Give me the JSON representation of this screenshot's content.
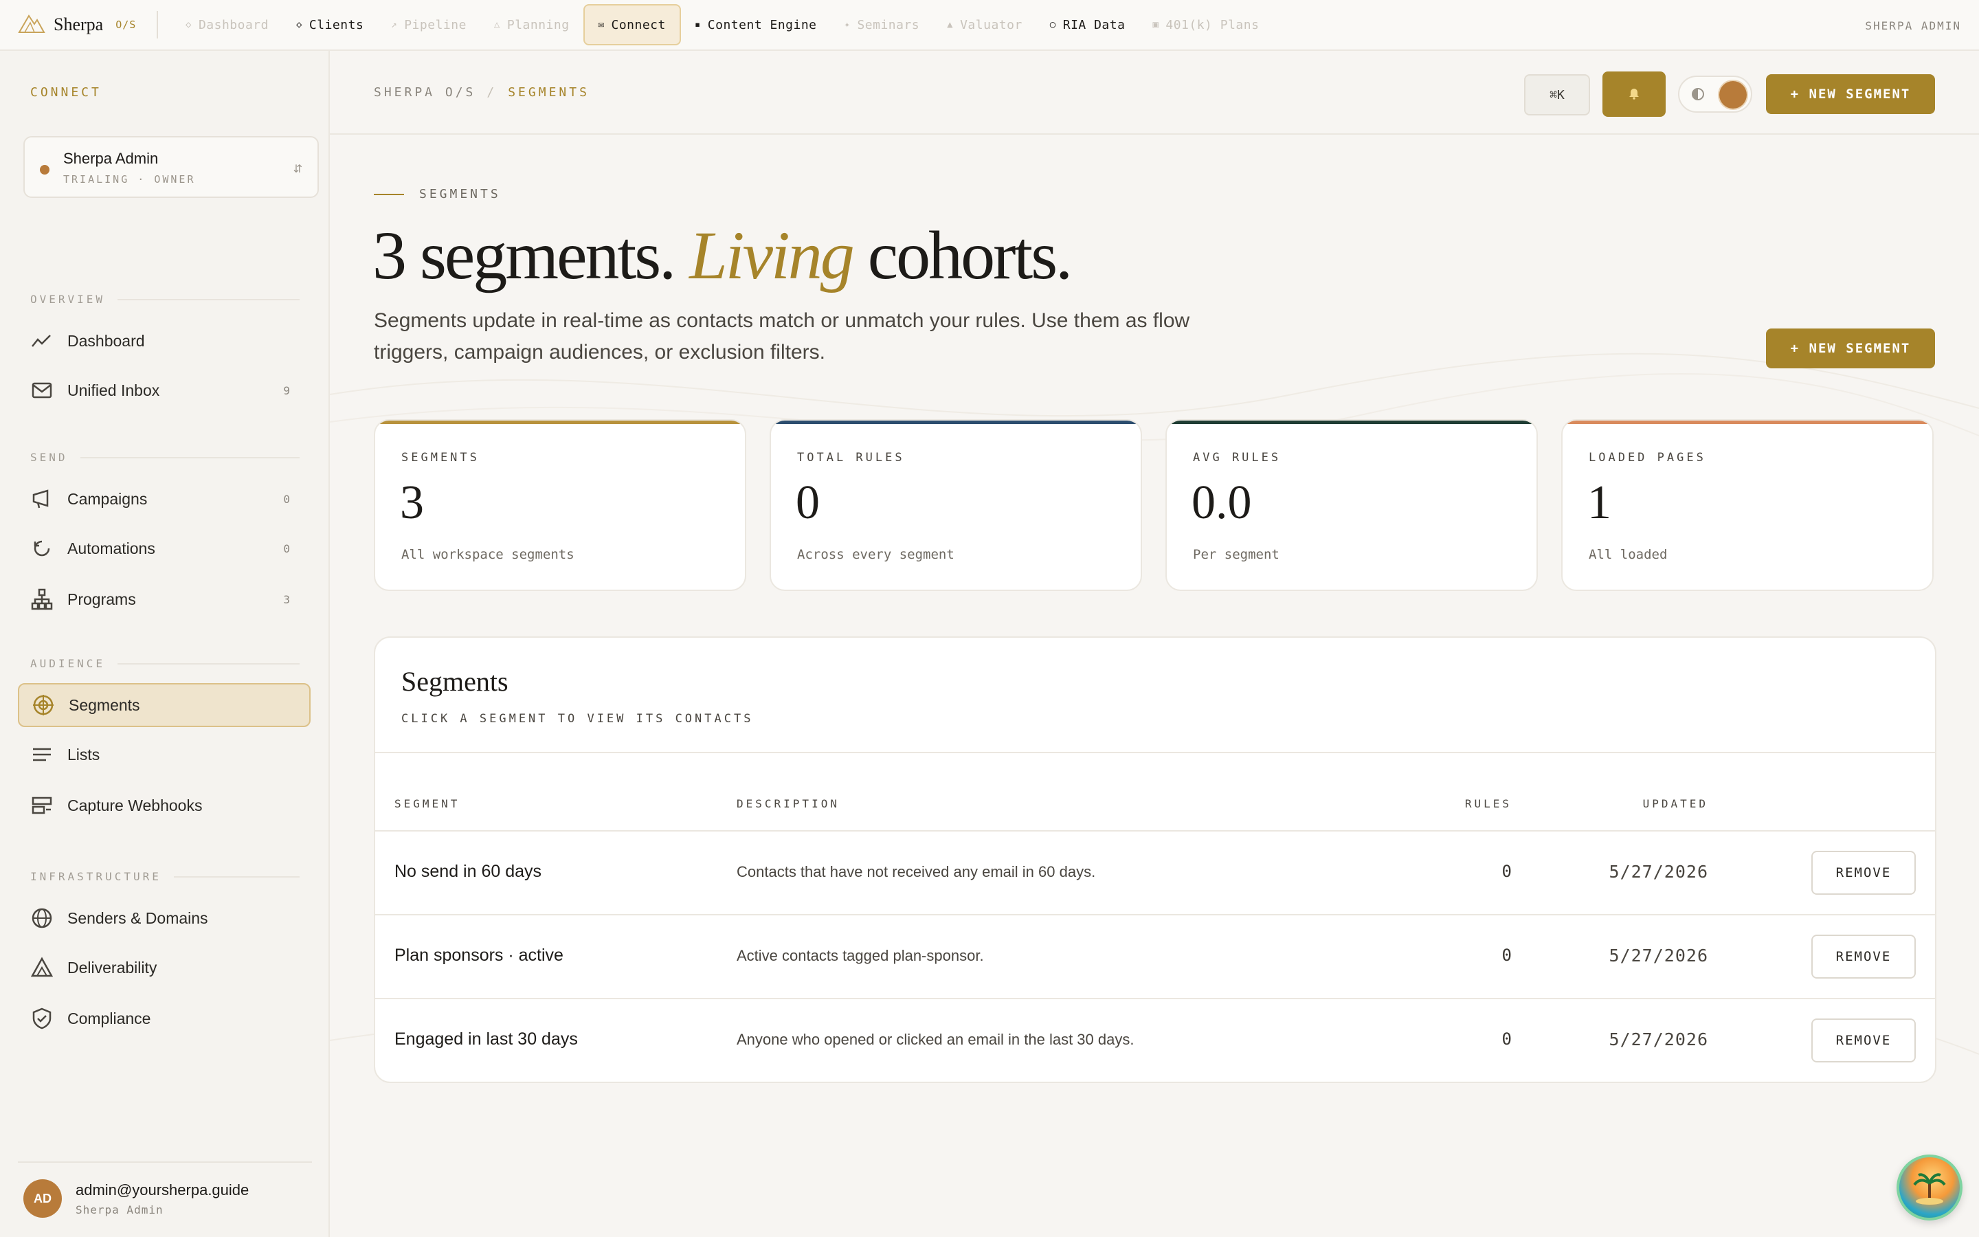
{
  "app": {
    "name": "Sherpa",
    "tag": "O/S",
    "user_label": "SHERPA ADMIN"
  },
  "topnav": [
    {
      "label": "Dashboard",
      "icon": "diamond-icon",
      "state": "dim"
    },
    {
      "label": "Clients",
      "icon": "diamond-icon",
      "state": "normal"
    },
    {
      "label": "Pipeline",
      "icon": "arrow-up-right-icon",
      "state": "dim"
    },
    {
      "label": "Planning",
      "icon": "triangle-icon",
      "state": "dim"
    },
    {
      "label": "Connect",
      "icon": "mail-icon",
      "state": "active"
    },
    {
      "label": "Content Engine",
      "icon": "square-icon",
      "state": "normal"
    },
    {
      "label": "Seminars",
      "icon": "sparkle-icon",
      "state": "dim"
    },
    {
      "label": "Valuator",
      "icon": "triangle-filled-icon",
      "state": "dim"
    },
    {
      "label": "RIA Data",
      "icon": "circle-icon",
      "state": "normal"
    },
    {
      "label": "401(k) Plans",
      "icon": "box-icon",
      "state": "dim"
    }
  ],
  "sidebar": {
    "heading": "CONNECT",
    "account": {
      "name": "Sherpa Admin",
      "sub": "TRIALING · OWNER",
      "switch_glyph": "⇵"
    },
    "sections": [
      {
        "label": "OVERVIEW",
        "items": [
          {
            "label": "Dashboard",
            "icon": "trend-icon",
            "count": ""
          },
          {
            "label": "Unified Inbox",
            "icon": "mail-icon",
            "count": "9"
          }
        ]
      },
      {
        "label": "SEND",
        "items": [
          {
            "label": "Campaigns",
            "icon": "megaphone-icon",
            "count": "0"
          },
          {
            "label": "Automations",
            "icon": "refresh-icon",
            "count": "0"
          },
          {
            "label": "Programs",
            "icon": "hierarchy-icon",
            "count": "3"
          }
        ]
      },
      {
        "label": "AUDIENCE",
        "items": [
          {
            "label": "Segments",
            "icon": "target-icon",
            "count": "",
            "active": true
          },
          {
            "label": "Lists",
            "icon": "lines-icon",
            "count": ""
          },
          {
            "label": "Capture Webhooks",
            "icon": "webhook-icon",
            "count": ""
          }
        ]
      },
      {
        "label": "INFRASTRUCTURE",
        "items": [
          {
            "label": "Senders & Domains",
            "icon": "globe-icon",
            "count": ""
          },
          {
            "label": "Deliverability",
            "icon": "triangle-icon",
            "count": ""
          },
          {
            "label": "Compliance",
            "icon": "shield-icon",
            "count": ""
          }
        ]
      }
    ],
    "user": {
      "initials": "AD",
      "email": "admin@yoursherpa.guide",
      "role": "Sherpa Admin"
    }
  },
  "header": {
    "breadcrumb_root": "SHERPA O/S",
    "breadcrumb_sep": "/",
    "breadcrumb_current": "SEGMENTS",
    "kbd_label": "⌘K",
    "new_segment_label": "+ NEW SEGMENT"
  },
  "hero": {
    "eyebrow": "SEGMENTS",
    "title_pre": "3 segments.",
    "title_accent": "Living",
    "title_post": "cohorts.",
    "description": "Segments update in real-time as contacts match or unmatch your rules. Use them as flow triggers, campaign audiences, or exclusion filters.",
    "cta_label": "+ NEW SEGMENT"
  },
  "stats": [
    {
      "label": "SEGMENTS",
      "value": "3",
      "sub": "All workspace segments",
      "color": "#b8923c"
    },
    {
      "label": "TOTAL RULES",
      "value": "0",
      "sub": "Across every segment",
      "color": "#2c4d6e"
    },
    {
      "label": "AVG RULES",
      "value": "0.0",
      "sub": "Per segment",
      "color": "#1f3d33"
    },
    {
      "label": "LOADED PAGES",
      "value": "1",
      "sub": "All loaded",
      "color": "#d98a5c"
    }
  ],
  "table": {
    "title": "Segments",
    "subtitle": "CLICK A SEGMENT TO VIEW ITS CONTACTS",
    "columns": {
      "segment": "SEGMENT",
      "description": "DESCRIPTION",
      "rules": "RULES",
      "updated": "UPDATED"
    },
    "rows": [
      {
        "name": "No send in 60 days",
        "description": "Contacts that have not received any email in 60 days.",
        "rules": "0",
        "updated": "5/27/2026",
        "action": "REMOVE"
      },
      {
        "name": "Plan sponsors · active",
        "description": "Active contacts tagged plan-sponsor.",
        "rules": "0",
        "updated": "5/27/2026",
        "action": "REMOVE"
      },
      {
        "name": "Engaged in last 30 days",
        "description": "Anyone who opened or clicked an email in the last 30 days.",
        "rules": "0",
        "updated": "5/27/2026",
        "action": "REMOVE"
      }
    ]
  },
  "colors": {
    "accent": "#a6842a",
    "background": "#f7f5f2",
    "sidebar": "#f5f3ef"
  }
}
